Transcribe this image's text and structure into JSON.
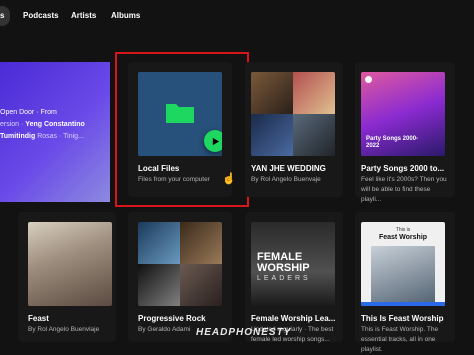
{
  "tabs": [
    "s",
    "Podcasts",
    "Artists",
    "Albums"
  ],
  "liked": {
    "lines": [
      "Open Door · From",
      "ersion · ",
      "Yeng Constantino",
      "Tumitindig",
      " Rosas · Tinig..."
    ]
  },
  "cards_row1": [
    {
      "title": "Local Files",
      "subtitle": "Files from your computer"
    },
    {
      "title": "YAN JHE WEDDING",
      "subtitle": "By Rol Angelo Buenvaje"
    },
    {
      "title": "Party Songs 2000 to...",
      "subtitle": "Feel like it's 2000s? Then you will be able to find these playli...",
      "art_text": "Party Songs 2000-2022"
    }
  ],
  "cards_row2": [
    {
      "title": "Feast",
      "subtitle": "By Rol Angelo Buenvlaje"
    },
    {
      "title": "Progressive Rock",
      "subtitle": "By Geraldo Adami"
    },
    {
      "title": "Female Worship Lea...",
      "subtitle": "Updated regularly · The best female led worship songs...",
      "art_text": [
        "FEMALE",
        "WORSHIP",
        "LEADERS"
      ]
    },
    {
      "title": "This Is Feast Worship",
      "subtitle": "This is Feast Worship. The essential tracks, all in one playlist.",
      "art_text": [
        "This is",
        "Feast Worship"
      ]
    }
  ],
  "watermark": "HEADPHONESTY",
  "colors": {
    "accent": "#1ed760",
    "highlight": "#d6161a",
    "background": "#121212",
    "card": "#181818"
  }
}
